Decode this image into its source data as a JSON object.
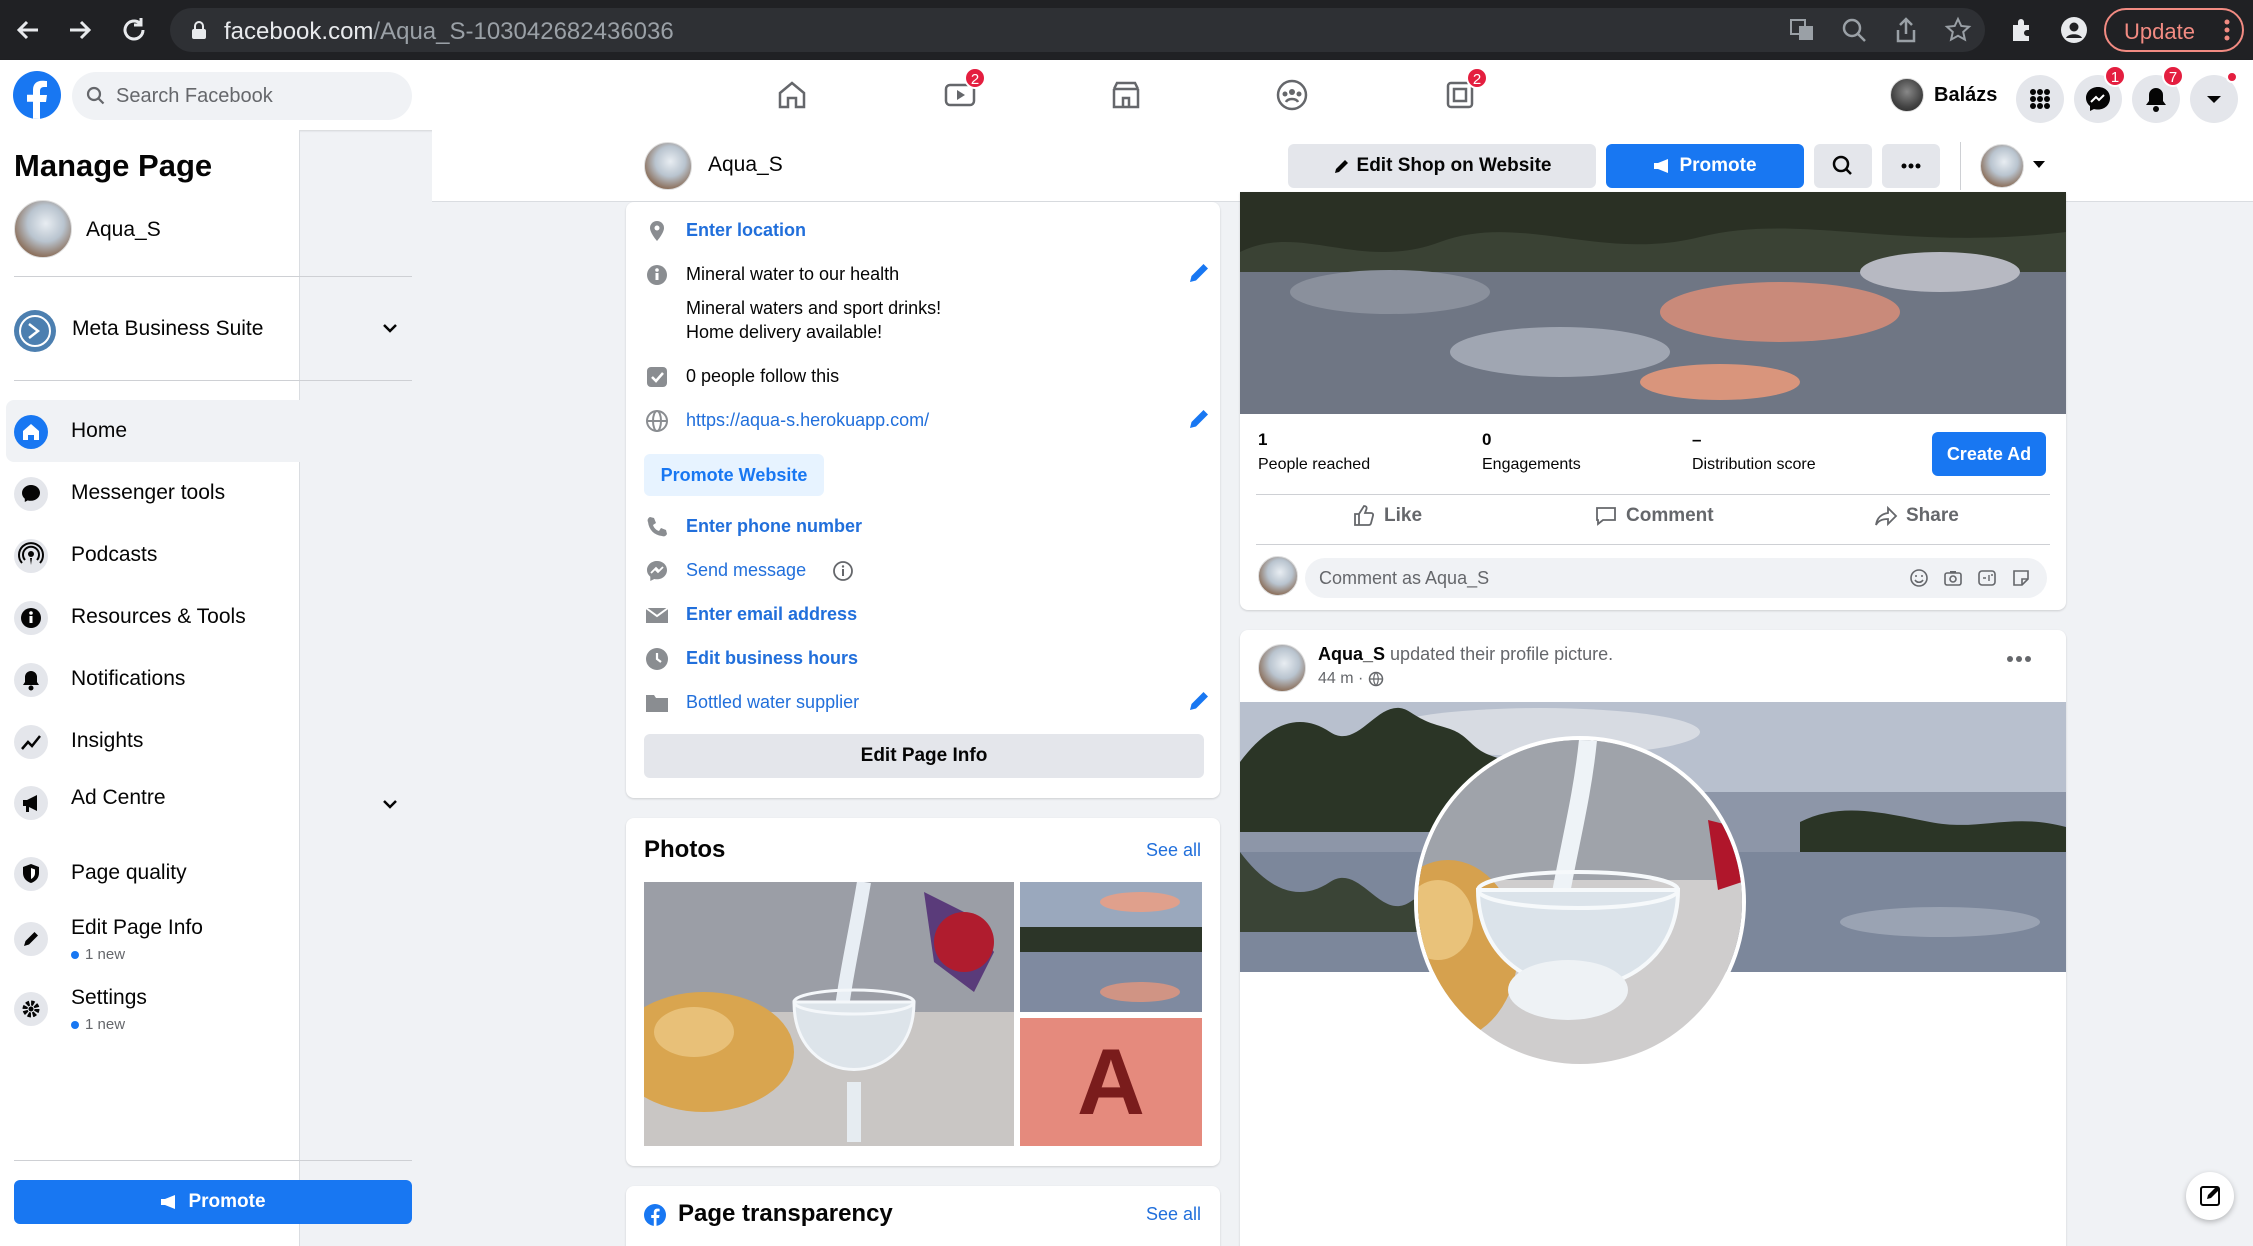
{
  "browser": {
    "url_domain": "facebook.com",
    "url_path": "/Aqua_S-103042682436036",
    "update_label": "Update"
  },
  "topbar": {
    "search_placeholder": "Search Facebook",
    "watch_badge": "2",
    "gaming_badge": "2",
    "user_name": "Balázs",
    "messenger_badge": "1",
    "notifications_badge": "7"
  },
  "sidebar": {
    "title": "Manage Page",
    "page_name": "Aqua_S",
    "business_suite": "Meta Business Suite",
    "items": [
      {
        "label": "Home"
      },
      {
        "label": "Messenger tools"
      },
      {
        "label": "Podcasts"
      },
      {
        "label": "Resources & Tools"
      },
      {
        "label": "Notifications"
      },
      {
        "label": "Insights"
      },
      {
        "label": "Ad Centre"
      },
      {
        "label": "Page quality"
      },
      {
        "label": "Edit Page Info",
        "sub": "1 new"
      },
      {
        "label": "Settings",
        "sub": "1 new"
      }
    ],
    "promote_label": "Promote"
  },
  "header": {
    "page_name": "Aqua_S",
    "edit_shop_label": "Edit Shop on Website",
    "promote_label": "Promote"
  },
  "about": {
    "location": "Enter location",
    "description": "Mineral water to our health",
    "details_line1": "Mineral waters and sport drinks!",
    "details_line2": "Home delivery available!",
    "followers": "0 people follow this",
    "website": "https://aqua-s.herokuapp.com/",
    "promote_website": "Promote Website",
    "phone": "Enter phone number",
    "send_message": "Send message",
    "email": "Enter email address",
    "hours": "Edit business hours",
    "category": "Bottled water supplier",
    "edit_page_info": "Edit Page Info"
  },
  "photos": {
    "title": "Photos",
    "see_all": "See all",
    "letter_tile": "A"
  },
  "transparency": {
    "title": "Page transparency",
    "see_all": "See all"
  },
  "post1": {
    "stats": [
      {
        "value": "1",
        "label": "People reached"
      },
      {
        "value": "0",
        "label": "Engagements"
      },
      {
        "value": "–",
        "label": "Distribution score"
      }
    ],
    "create_ad": "Create Ad",
    "like": "Like",
    "comment": "Comment",
    "share": "Share",
    "comment_placeholder": "Comment as Aqua_S"
  },
  "post2": {
    "author": "Aqua_S",
    "action": "updated their profile picture.",
    "time": "44 m ·"
  },
  "colors": {
    "brand": "#1877f2",
    "badge": "#e41e3f",
    "link": "#216fdb"
  }
}
